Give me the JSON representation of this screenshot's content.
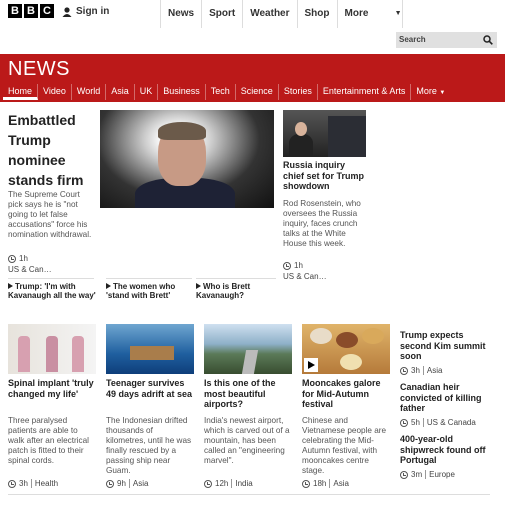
{
  "top_bar": {
    "logo_letters": [
      "B",
      "B",
      "C"
    ],
    "signin_label": "Sign in",
    "nav": [
      "News",
      "Sport",
      "Weather",
      "Shop",
      "More"
    ],
    "search_placeholder": "Search"
  },
  "news_header": {
    "title": "NEWS",
    "nav": [
      "Home",
      "Video",
      "World",
      "Asia",
      "UK",
      "Business",
      "Tech",
      "Science",
      "Stories",
      "Entertainment & Arts",
      "More"
    ],
    "active": "Home",
    "brand_color": "#bb1919"
  },
  "lead": {
    "headline": "Embattled Trump nominee stands firm",
    "summary": "The Supreme Court pick says he is \"not going to let false accusations\" force his nomination withdrawal.",
    "time": "1h",
    "tag": "US & Can…",
    "related": [
      "Trump: 'I'm with Kavanaugh all the way'",
      "The women who 'stand with Brett'",
      "Who is Brett Kavanaugh?"
    ]
  },
  "secondary": {
    "headline": "Russia inquiry chief set for Trump showdown",
    "summary": "Rod Rosenstein, who oversees the Russia inquiry, faces crunch talks at the White House this week.",
    "time": "1h",
    "tag": "US & Can…"
  },
  "stories": [
    {
      "headline": "Spinal implant 'truly changed my life'",
      "summary": "Three paralysed patients are able to walk after an electrical patch is fitted to their spinal cords.",
      "time": "3h",
      "tag": "Health"
    },
    {
      "headline": "Teenager survives 49 days adrift at sea",
      "summary": "The Indonesian drifted thousands of kilometres, until he was finally rescued by a passing ship near Guam.",
      "time": "9h",
      "tag": "Asia"
    },
    {
      "headline": "Is this one of the most beautiful airports?",
      "summary": "India's newest airport, which is carved out of a mountain, has been called an \"engineering marvel\".",
      "time": "12h",
      "tag": "India"
    },
    {
      "headline": "Mooncakes galore for Mid-Autumn festival",
      "summary": "Chinese and Vietnamese people are celebrating the Mid-Autumn festival, with mooncakes centre stage.",
      "time": "18h",
      "tag": "Asia"
    }
  ],
  "sidebar": [
    {
      "headline": "Trump expects second Kim summit soon",
      "time": "3h",
      "tag": "Asia"
    },
    {
      "headline": "Canadian heir convicted of killing father",
      "time": "5h",
      "tag": "US & Canada"
    },
    {
      "headline": "400-year-old shipwreck found off Portugal",
      "time": "3m",
      "tag": "Europe"
    }
  ]
}
